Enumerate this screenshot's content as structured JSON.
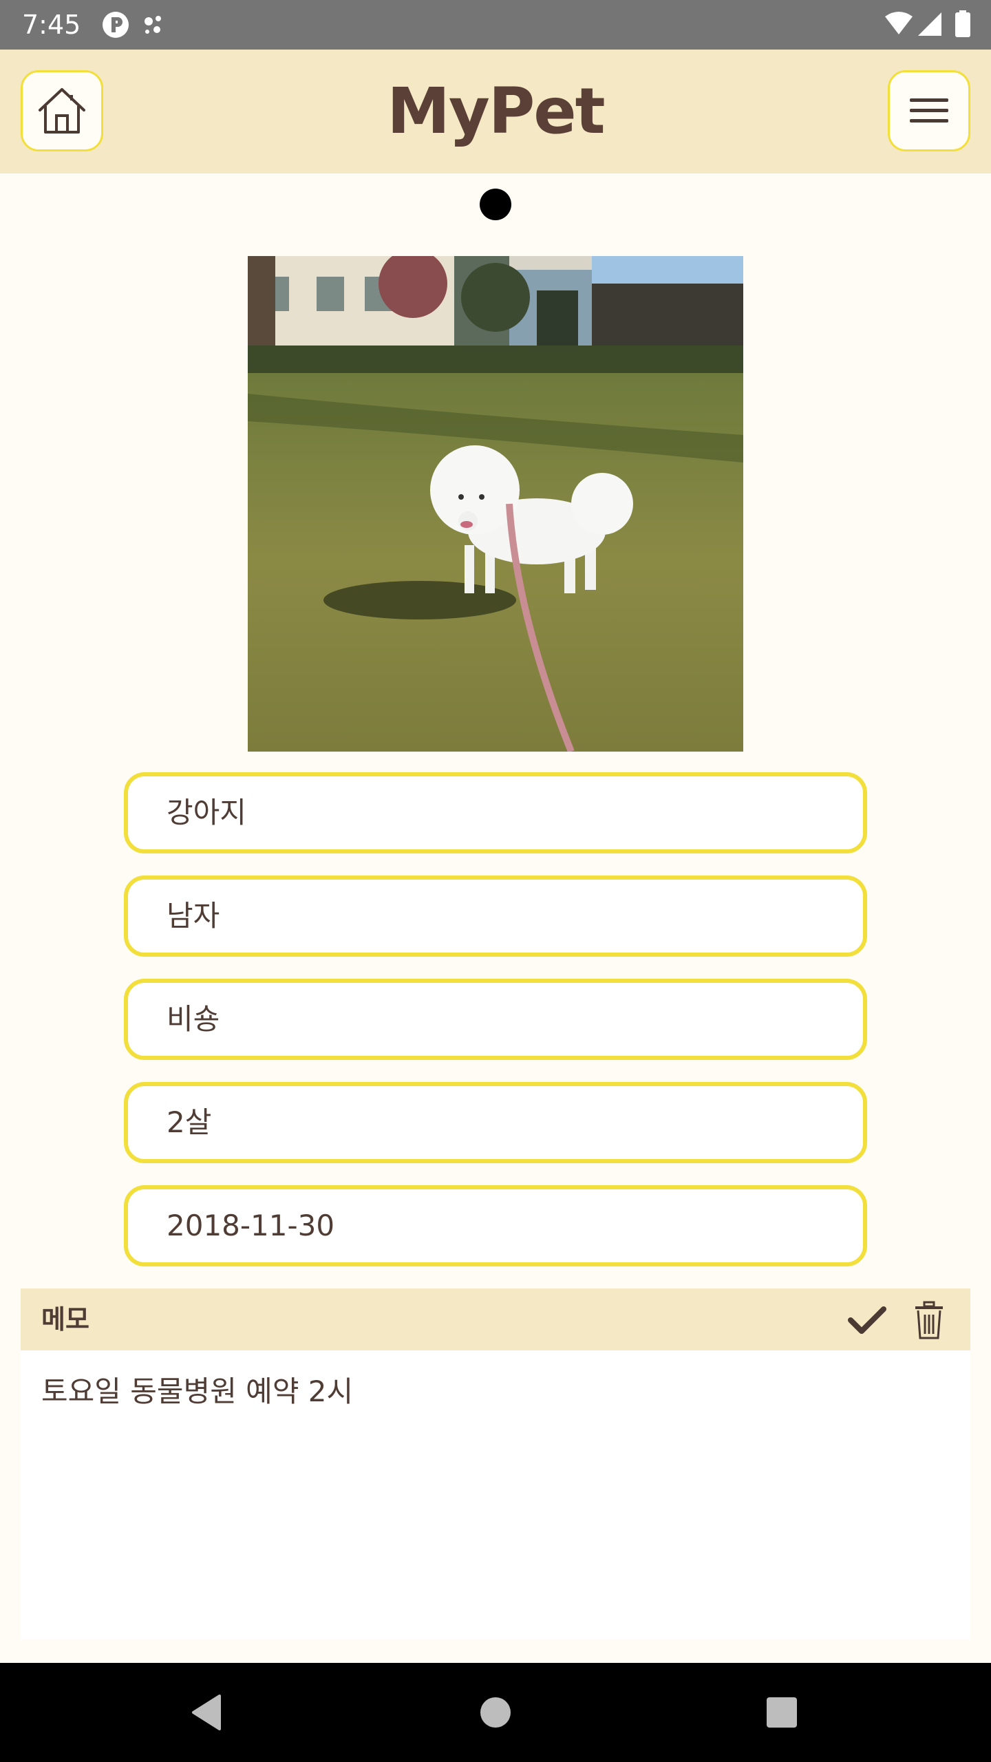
{
  "status_bar": {
    "time": "7:45",
    "icons": [
      "p-badge-icon",
      "assistant-dots-icon",
      "wifi-icon",
      "cell-signal-icon",
      "battery-icon"
    ]
  },
  "app_bar": {
    "title": "MyPet",
    "home_icon": "house-icon",
    "menu_icon": "hamburger-menu-icon"
  },
  "pager": {
    "indicator": "page-dot"
  },
  "pet": {
    "photo": "white bichon dog on grass with pink leash",
    "species": "강아지",
    "gender": "남자",
    "breed": "비숑",
    "age": "2살",
    "date": "2018-11-30"
  },
  "memo": {
    "title": "메모",
    "content": "토요일 동물병원 예약 2시",
    "confirm_icon": "checkmark-icon",
    "delete_icon": "trash-icon"
  },
  "nav_bar": {
    "icons": [
      "back-triangle-icon",
      "home-circle-icon",
      "recents-square-icon"
    ]
  },
  "colors": {
    "app_bar_bg": "#F5E8C4",
    "field_border": "#F2DF3B",
    "text_brown": "#5a4036",
    "page_bg": "#FFFBF5"
  }
}
